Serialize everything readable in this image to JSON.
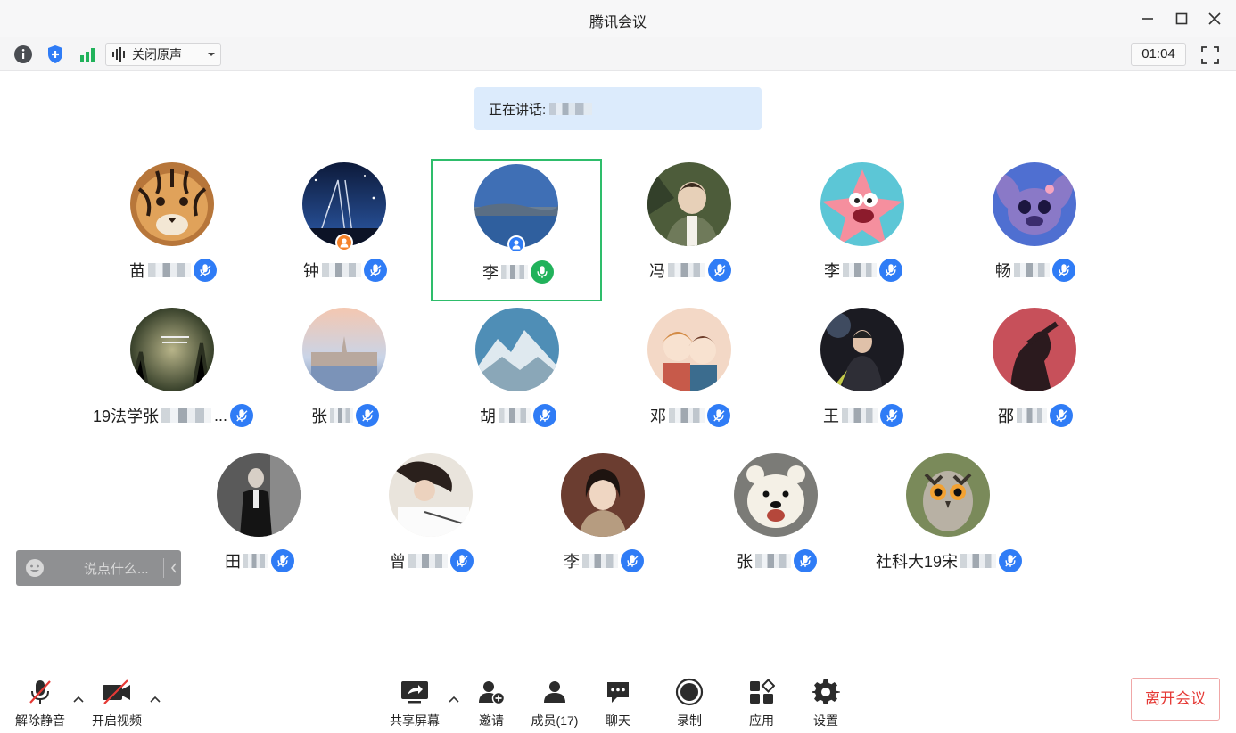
{
  "window": {
    "title": "腾讯会议"
  },
  "toolbar": {
    "audio_label": "关闭原声",
    "timer": "01:04"
  },
  "speaking": {
    "prefix": "正在讲话:"
  },
  "participants": [
    {
      "name": "苗",
      "mic": "muted",
      "badge": "",
      "avatar": "tiger"
    },
    {
      "name": "钟",
      "mic": "muted",
      "badge": "host",
      "avatar": "night-sky"
    },
    {
      "name": "李",
      "mic": "speaking",
      "badge": "self",
      "avatar": "lake",
      "active": true
    },
    {
      "name": "冯",
      "mic": "muted",
      "badge": "",
      "avatar": "forest-portrait"
    },
    {
      "name": "李",
      "mic": "muted",
      "badge": "",
      "avatar": "patrick-star"
    },
    {
      "name": "畅",
      "mic": "muted",
      "badge": "",
      "avatar": "stitch"
    },
    {
      "name": "19法学张",
      "suffix": "...",
      "mic": "muted",
      "badge": "",
      "avatar": "quote-forest"
    },
    {
      "name": "张",
      "mic": "muted",
      "badge": "",
      "avatar": "parliament"
    },
    {
      "name": "胡",
      "mic": "muted",
      "badge": "",
      "avatar": "mountain"
    },
    {
      "name": "邓",
      "mic": "muted",
      "badge": "",
      "avatar": "anime-pair"
    },
    {
      "name": "王",
      "mic": "muted",
      "badge": "",
      "avatar": "stage-performer"
    },
    {
      "name": "邵",
      "mic": "muted",
      "badge": "",
      "avatar": "red-silhouette"
    },
    {
      "name": "田",
      "mic": "muted",
      "badge": "",
      "avatar": "suited-man"
    },
    {
      "name": "曾",
      "mic": "muted",
      "badge": "",
      "avatar": "student-writing"
    },
    {
      "name": "李",
      "mic": "muted",
      "badge": "",
      "avatar": "girl-portrait"
    },
    {
      "name": "张",
      "mic": "muted",
      "badge": "",
      "avatar": "polar-bear"
    },
    {
      "name": "社科大19宋",
      "mic": "muted",
      "badge": "",
      "avatar": "owl"
    }
  ],
  "chat": {
    "placeholder": "说点什么..."
  },
  "bottombar": {
    "unmute": "解除静音",
    "video": "开启视频",
    "share": "共享屏幕",
    "invite": "邀请",
    "members": "成员(17)",
    "chat": "聊天",
    "record": "录制",
    "apps": "应用",
    "settings": "设置",
    "leave": "离开会议"
  },
  "colors": {
    "accent": "#2f7cf6",
    "speaking_green": "#21b25b",
    "active_border": "#2ebd6b",
    "leave_red": "#e53935",
    "host_orange": "#f5822a"
  }
}
